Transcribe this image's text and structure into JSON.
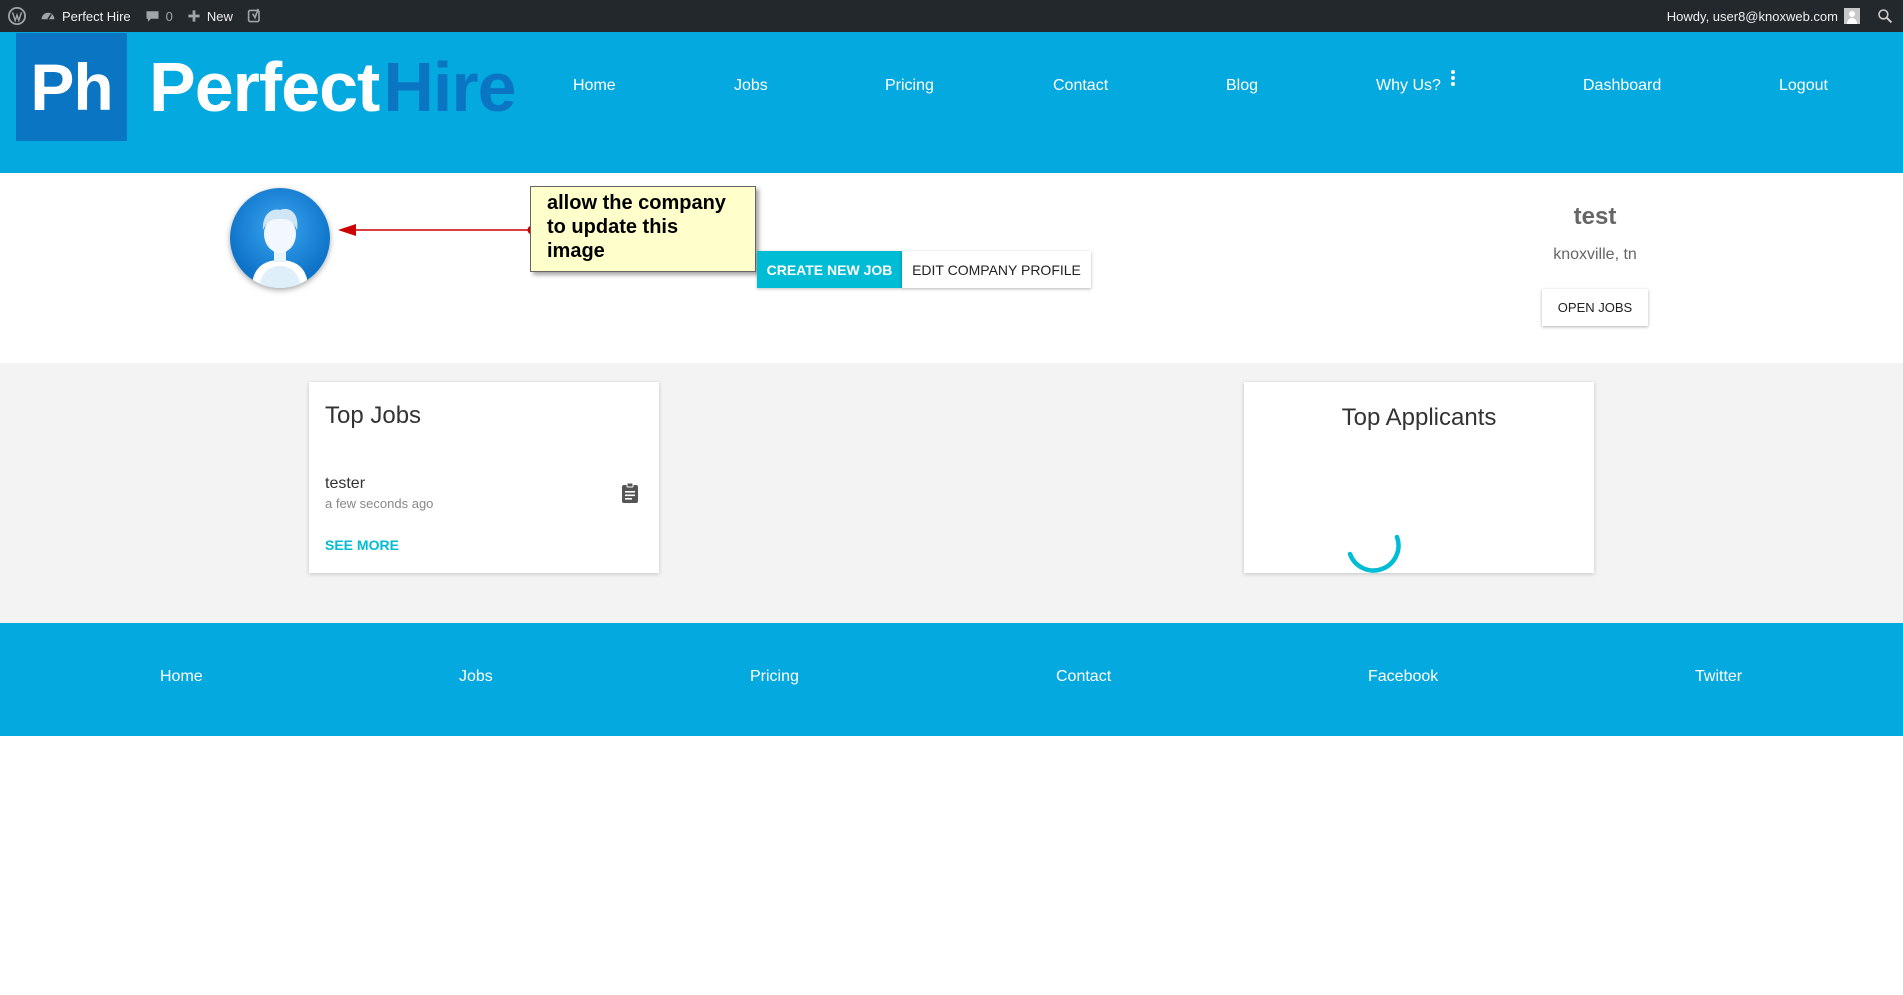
{
  "admin_bar": {
    "site_name": "Perfect Hire",
    "comments_count": "0",
    "new_label": "New",
    "greeting": "Howdy, user8@knoxweb.com"
  },
  "header": {
    "logo_mark": "Ph",
    "logo_word1": "Perfect",
    "logo_word2": "Hire",
    "nav": [
      "Home",
      "Jobs",
      "Pricing",
      "Contact",
      "Blog",
      "Why Us?",
      "Dashboard",
      "Logout"
    ]
  },
  "profile": {
    "callout_text": "allow the company to update this image",
    "create_job_label": "CREATE NEW JOB",
    "edit_profile_label": "EDIT COMPANY PROFILE",
    "company_name": "test",
    "company_location": "knoxville, tn",
    "open_jobs_label": "OPEN JOBS"
  },
  "top_jobs": {
    "title": "Top Jobs",
    "items": [
      {
        "title": "tester",
        "time": "a few seconds ago"
      }
    ],
    "see_more_label": "SEE MORE"
  },
  "top_applicants": {
    "title": "Top Applicants"
  },
  "footer": {
    "links": [
      "Home",
      "Jobs",
      "Pricing",
      "Contact",
      "Facebook",
      "Twitter"
    ]
  },
  "colors": {
    "header_bg": "#03a9df",
    "logo_dark": "#0a76c3",
    "accent": "#00bcd4",
    "admin_bar_bg": "#23282d",
    "callout_bg": "#ffffcc",
    "arrow": "#cc0000"
  },
  "icons": [
    "wordpress-icon",
    "dashboard-icon",
    "comment-icon",
    "plus-icon",
    "yoast-icon",
    "search-icon",
    "clipboard-icon",
    "more-vert-icon"
  ]
}
